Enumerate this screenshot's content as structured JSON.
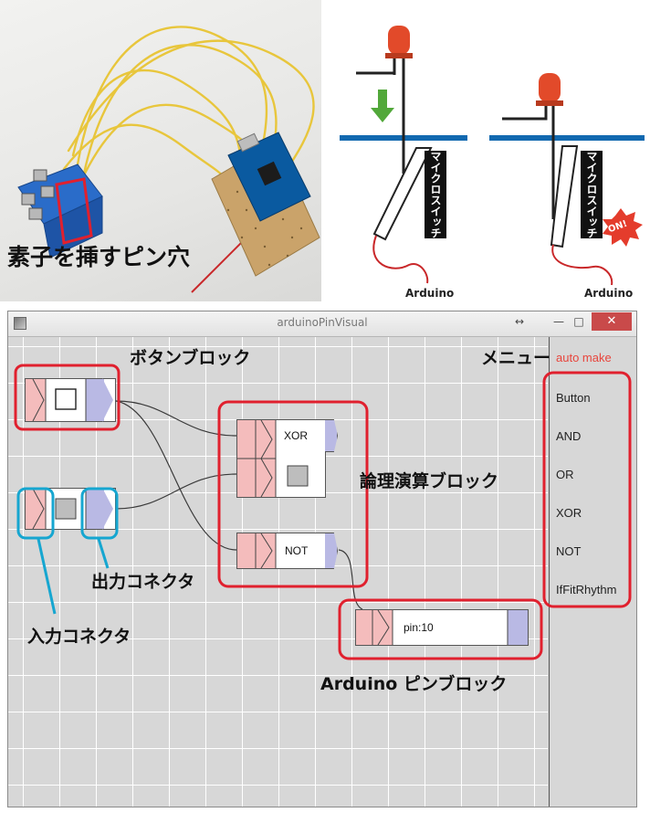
{
  "photo": {
    "caption": "素子を挿すピン穴"
  },
  "diagram": {
    "switch_label_left": "マイクロスイッチ",
    "switch_label_right": "マイクロスイッチ",
    "arduino_left": "Arduino",
    "arduino_right": "Arduino",
    "on_badge": "ON!"
  },
  "window": {
    "title": "arduinoPinVisual",
    "resize_glyph": "↔",
    "minimize": "—",
    "maximize": "□",
    "close": "✕"
  },
  "menu": {
    "items": [
      "auto make",
      "Button",
      "AND",
      "OR",
      "XOR",
      "NOT",
      "IfFitRhythm"
    ]
  },
  "blocks": {
    "xor_label": "XOR",
    "not_label": "NOT",
    "pin_label": "pin:10"
  },
  "annotations": {
    "button_block": "ボタンブロック",
    "menu": "メニュー",
    "logic_block": "論理演算ブロック",
    "output_connector": "出力コネクタ",
    "input_connector": "入力コネクタ",
    "arduino_pin_block": "Arduino ピンブロック"
  },
  "colors": {
    "input_connector": "#f4bcbc",
    "output_connector": "#b9b9e4",
    "highlight_red": "#e0202e",
    "highlight_blue": "#16a6d0",
    "accent_menu": "#e8453c",
    "pcb_blue": "#0a5aa0"
  },
  "icons": {
    "app": "app-icon",
    "led": "led-icon",
    "arrow": "down-arrow-icon",
    "chip": "microcontroller-icon"
  }
}
